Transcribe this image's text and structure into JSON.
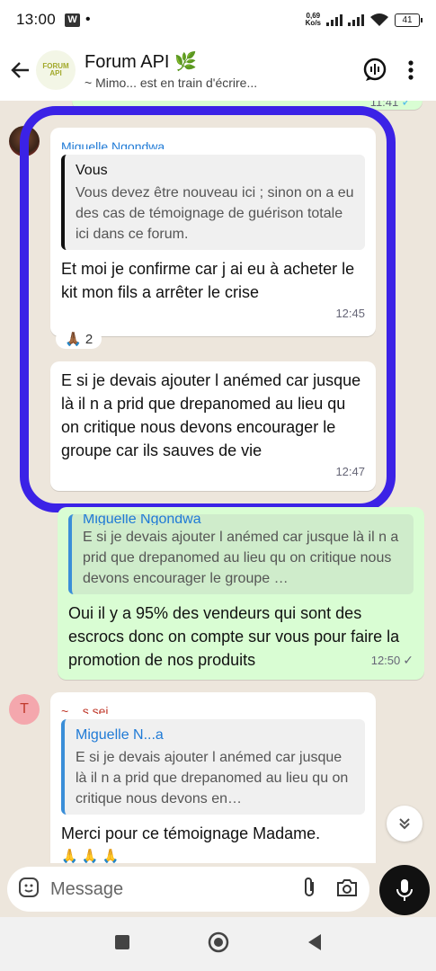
{
  "status_bar": {
    "time": "13:00",
    "app_badge": "W",
    "dot": "•",
    "speed_value": "0,69",
    "speed_unit": "Ko/s",
    "battery": "41"
  },
  "header": {
    "title": "Forum API 🌿",
    "subtitle": "~ Mimo... est en train d'écrire...",
    "avatar_text": "FORUM API"
  },
  "messages": {
    "top_partial_time": "11:41",
    "msg1": {
      "sender": "Miguelle Ngondwa",
      "quote_name": "Vous",
      "quote_text": "Vous devez être nouveau ici ; sinon on a eu des cas de témoignage de guérison totale ici dans ce forum.",
      "text": "Et moi je confirme car j ai eu à acheter le kit mon fils a arrêter le crise",
      "time": "12:45",
      "reaction": "🙏🏾 2"
    },
    "msg2": {
      "text": "E si je devais ajouter l anémed car jusque là il n a prid que drepanomed au lieu qu on critique nous devons encourager le groupe car ils sauves de vie",
      "time": "12:47"
    },
    "msg3": {
      "quote_name": "Miguelle Ngondwa",
      "quote_text": "E si je devais ajouter l anémed car jusque là il n a prid que drepanomed au lieu qu on critique nous devons encourager le groupe …",
      "text": "Oui il y a 95% des vendeurs qui sont des escrocs donc on compte sur vous pour faire la promotion de nos produits",
      "time": "12:50",
      "check": "✓"
    },
    "msg4": {
      "avatar_letter": "T",
      "sender": "~ ...s sei",
      "quote_name": "Miguelle N...a",
      "quote_text": "E si je devais ajouter l anémed car jusque là il n a prid que drepanomed au lieu qu on critique nous devons en…",
      "text": "Merci pour ce témoignage Madame.",
      "emojis": "🙏 🙏 🙏"
    }
  },
  "composer": {
    "placeholder": "Message"
  },
  "colors": {
    "annotation": "#3b22e6",
    "incoming": "#ffffff",
    "outgoing": "#d9fdd3",
    "background": "#ede6dc"
  },
  "icons": [
    "back-arrow-icon",
    "voice-chat-icon",
    "more-vert-icon",
    "sticker-icon",
    "attach-icon",
    "camera-icon",
    "mic-icon",
    "scroll-down-icon",
    "nav-square-icon",
    "nav-home-icon",
    "nav-back-icon"
  ]
}
